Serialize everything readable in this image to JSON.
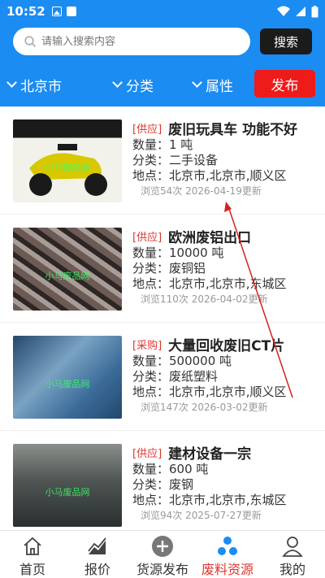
{
  "status": {
    "time": "10:52"
  },
  "search": {
    "placeholder": "请输入搜索内容",
    "button": "搜索"
  },
  "filters": {
    "city": "北京市",
    "category": "分类",
    "attribute": "属性",
    "publish": "发布"
  },
  "listings": [
    {
      "tag": "[供应]",
      "title": "废旧玩具车 功能不好",
      "qty": "数量：1 吨",
      "cat": "分类：二手设备",
      "loc": "地点：北京市,北京市,顺义区",
      "meta": "浏览54次 2026-04-19更新",
      "watermark": "小马废品网",
      "colors": [
        "#1a1a1a",
        "#d8c800",
        "#f2f2ea"
      ]
    },
    {
      "tag": "[供应]",
      "title": "欧洲废铝出口",
      "qty": "数量：10000 吨",
      "cat": "分类：废铜铝",
      "loc": "地点：北京市,北京市,东城区",
      "meta": "浏览110次 2026-04-02更新",
      "watermark": "小马废品网",
      "colors": [
        "#6c5a54",
        "#a89c97",
        "#2d2624"
      ]
    },
    {
      "tag": "[采购]",
      "title": "大量回收废旧CT片",
      "qty": "数量：500000 吨",
      "cat": "分类：废纸塑料",
      "loc": "地点：北京市,北京市,顺义区",
      "meta": "浏览147次 2026-03-02更新",
      "watermark": "小马废品网",
      "colors": [
        "#3b6c99",
        "#7aa2c2",
        "#23486c"
      ]
    },
    {
      "tag": "[供应]",
      "title": "建材设备一宗",
      "qty": "数量：600 吨",
      "cat": "分类：废钢",
      "loc": "地点：北京市,北京市,东城区",
      "meta": "浏览94次 2025-07-27更新",
      "watermark": "小马废品网",
      "colors": [
        "#4e5553",
        "#8a8f8b",
        "#2a2f2f"
      ]
    }
  ],
  "tabs": [
    {
      "label": "首页",
      "icon": "home-icon"
    },
    {
      "label": "报价",
      "icon": "chart-icon"
    },
    {
      "label": "货源发布",
      "icon": "plus-circle-icon"
    },
    {
      "label": "废料资源",
      "icon": "resources-icon",
      "active": true
    },
    {
      "label": "我的",
      "icon": "user-icon"
    }
  ],
  "accent": "#1a8cf2",
  "danger": "#ee1b1b"
}
